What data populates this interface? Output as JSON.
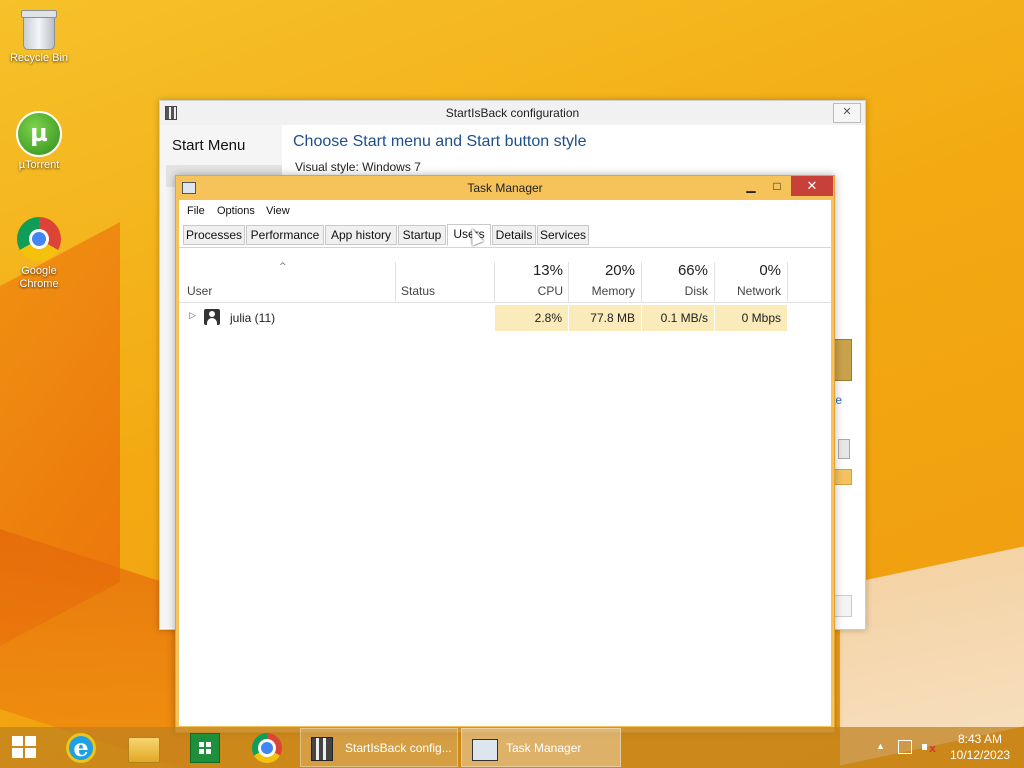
{
  "desktop": {
    "icons": [
      {
        "label": "Recycle Bin",
        "icon": "recycle-bin-icon"
      },
      {
        "label": "µTorrent",
        "icon": "utorrent-icon"
      },
      {
        "label": "Google Chrome",
        "icon": "chrome-icon"
      }
    ],
    "utorrent_glyph": "µ"
  },
  "startisback": {
    "title": "StartIsBack configuration",
    "close_glyph": "✕",
    "nav_title": "Start Menu",
    "heading": "Choose Start menu and Start button style",
    "visual_style_label": "Visual style:",
    "visual_style_value": "Windows 7"
  },
  "task_manager": {
    "title": "Task Manager",
    "controls": {
      "minimize": "▁",
      "maximize": "□",
      "close": "✕"
    },
    "menu": [
      "File",
      "Options",
      "View"
    ],
    "tabs": [
      {
        "label": "Processes"
      },
      {
        "label": "Performance"
      },
      {
        "label": "App history"
      },
      {
        "label": "Startup"
      },
      {
        "label": "Users",
        "active": true
      },
      {
        "label": "Details"
      },
      {
        "label": "Services"
      }
    ],
    "columns": {
      "user": "User",
      "status": "Status",
      "cpu": {
        "pct": "13%",
        "label": "CPU"
      },
      "memory": {
        "pct": "20%",
        "label": "Memory"
      },
      "disk": {
        "pct": "66%",
        "label": "Disk"
      },
      "network": {
        "pct": "0%",
        "label": "Network"
      }
    },
    "sort_glyph": "^",
    "rows": [
      {
        "expand": "▷",
        "user": "julia (11)",
        "status": "",
        "cpu": "2.8%",
        "memory": "77.8 MB",
        "disk": "0.1 MB/s",
        "network": "0 Mbps"
      }
    ]
  },
  "taskbar": {
    "pinned": [
      "start-icon",
      "internet-explorer-icon",
      "file-explorer-icon",
      "windows-store-icon",
      "chrome-icon"
    ],
    "ie_glyph": "e",
    "apps": [
      {
        "label": "StartIsBack config...",
        "active": false
      },
      {
        "label": "Task Manager",
        "active": true
      }
    ],
    "tray_arrow": "▲",
    "clock_time": "8:43 AM",
    "clock_date": "10/12/2023"
  }
}
